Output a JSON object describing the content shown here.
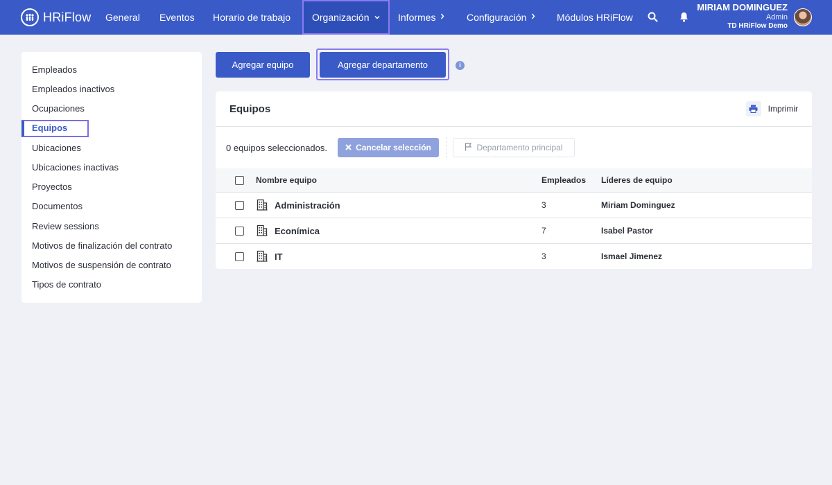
{
  "header": {
    "logo_text": "HRiFlow",
    "nav": [
      {
        "label": "General"
      },
      {
        "label": "Eventos"
      },
      {
        "label": "Horario de trabajo"
      },
      {
        "label": "Organización"
      },
      {
        "label": "Informes"
      },
      {
        "label": "Configuración"
      },
      {
        "label": "Módulos HRiFlow"
      }
    ],
    "user": {
      "name": "MIRIAM DOMINGUEZ",
      "role": "Admin",
      "company": "TD HRiFlow Demo"
    }
  },
  "sidebar": {
    "items": [
      {
        "label": "Empleados"
      },
      {
        "label": "Empleados inactivos"
      },
      {
        "label": "Ocupaciones"
      },
      {
        "label": "Equipos"
      },
      {
        "label": "Ubicaciones"
      },
      {
        "label": "Ubicaciones inactivas"
      },
      {
        "label": "Proyectos"
      },
      {
        "label": "Documentos"
      },
      {
        "label": "Review sessions"
      },
      {
        "label": "Motivos de finalización del contrato"
      },
      {
        "label": "Motivos de suspensión de contrato"
      },
      {
        "label": "Tipos de contrato"
      }
    ]
  },
  "actions": {
    "add_team": "Agregar equipo",
    "add_department": "Agregar departamento"
  },
  "card": {
    "title": "Equipos",
    "print_label": "Imprimir",
    "selection_text": "0 equipos seleccionados.",
    "cancel_label": "Cancelar selección",
    "main_dept_label": "Departamento principal",
    "columns": {
      "name": "Nombre equipo",
      "employees": "Empleados",
      "leaders": "Líderes de equipo"
    },
    "rows": [
      {
        "name": "Administración",
        "employees": "3",
        "leader": "Miriam Dominguez"
      },
      {
        "name": "Econímica",
        "employees": "7",
        "leader": "Isabel Pastor"
      },
      {
        "name": "IT",
        "employees": "3",
        "leader": "Ismael Jimenez"
      }
    ]
  },
  "colors": {
    "brand": "#3a5bc7",
    "focus_outline": "#8a7bf0",
    "background": "#eff1f6"
  }
}
